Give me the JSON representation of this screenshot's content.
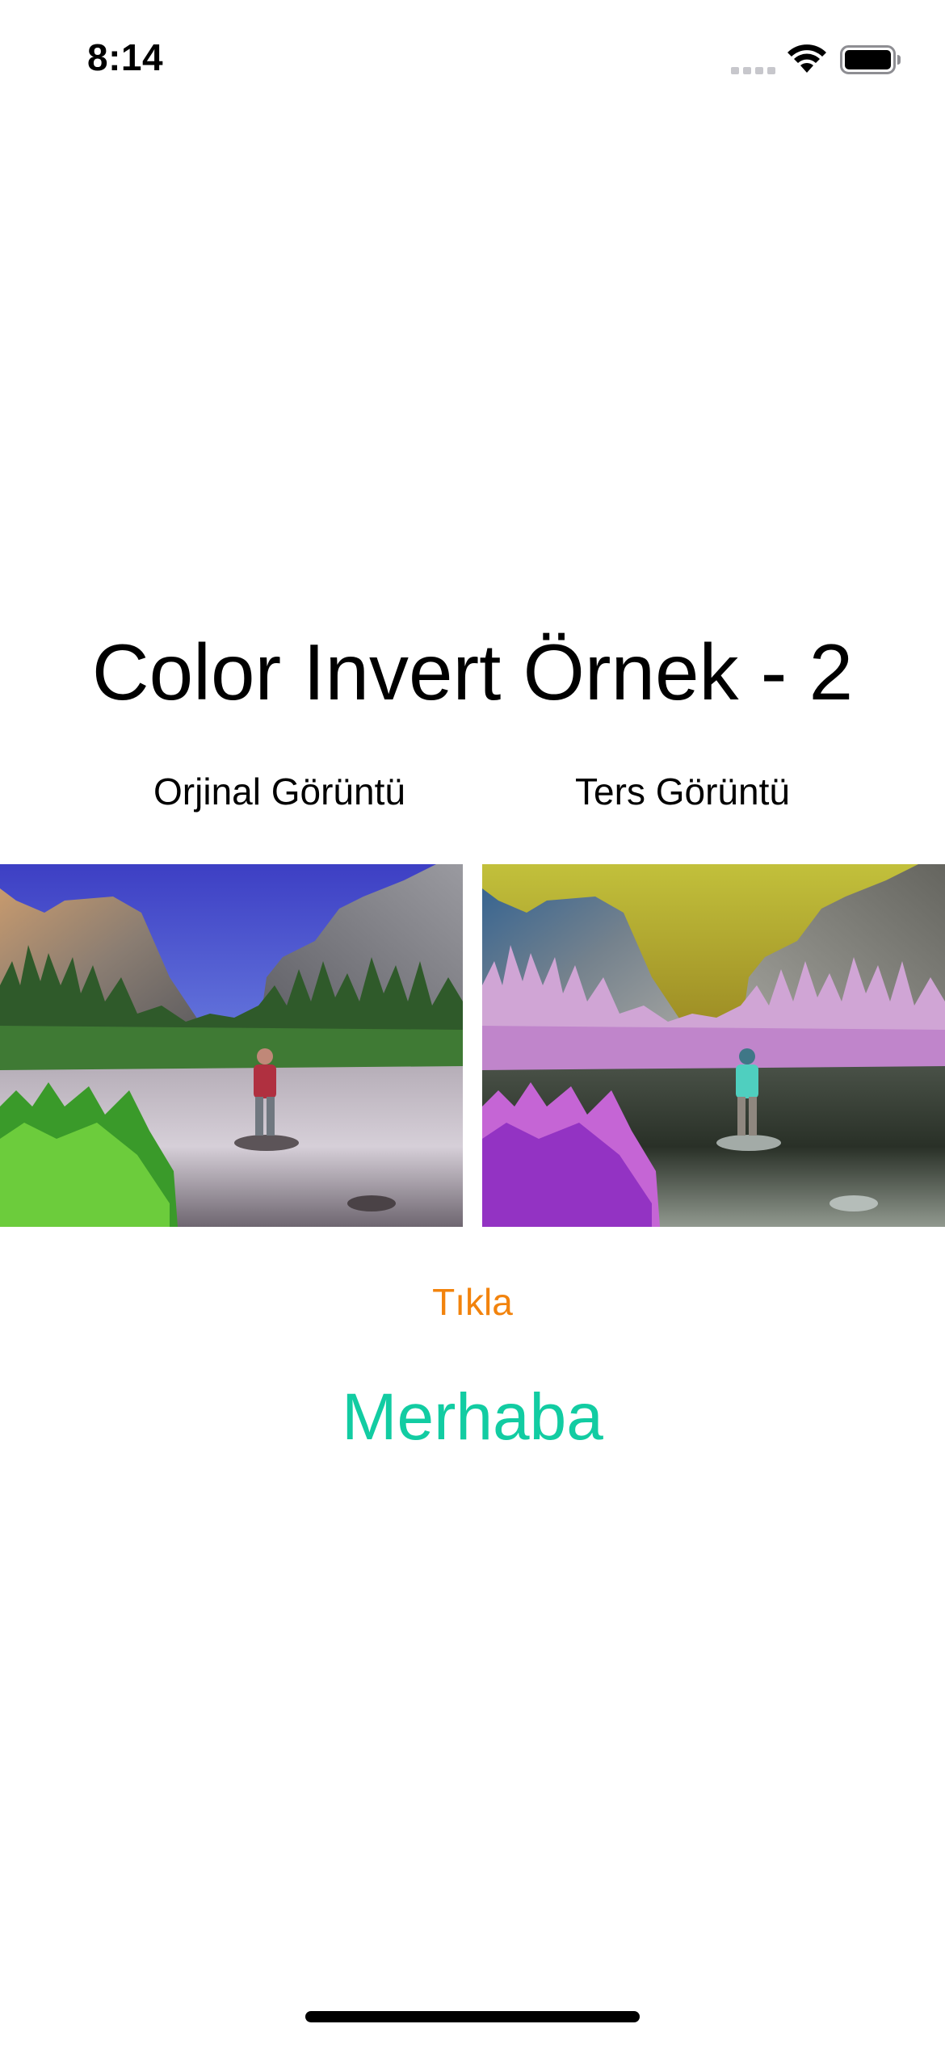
{
  "status_bar": {
    "time": "8:14",
    "icons": [
      "cellular-signal-icon",
      "wifi-icon",
      "battery-icon"
    ]
  },
  "title": "Color Invert Örnek - 2",
  "captions": {
    "original": "Orjinal Görüntü",
    "inverted": "Ters Görüntü"
  },
  "images": {
    "original_subject": "landscape photo: person standing on rock in river between granite cliffs",
    "inverted_subject": "color-inverted version of the same landscape photo"
  },
  "button": {
    "label": "Tıkla",
    "color": "#F2830D"
  },
  "greeting": {
    "text": "Merhaba",
    "color": "#12CCA2"
  }
}
